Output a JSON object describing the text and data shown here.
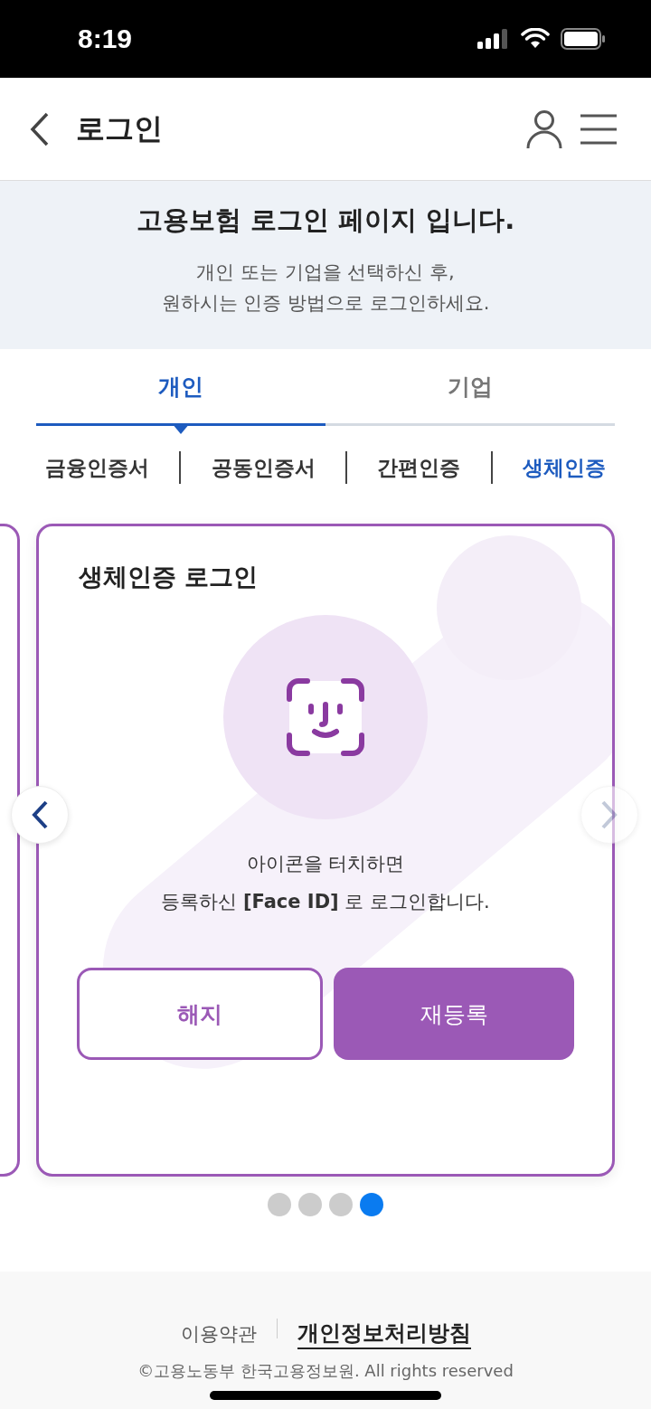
{
  "status_bar": {
    "time": "8:19"
  },
  "header": {
    "title": "로그인"
  },
  "intro": {
    "title": "고용보험 로그인 페이지 입니다.",
    "lines": [
      "개인 또는 기업을 선택하신 후,",
      "원하시는 인증 방법으로 로그인하세요."
    ]
  },
  "tabs": [
    {
      "label": "개인",
      "selected": true
    },
    {
      "label": "기업",
      "selected": false
    }
  ],
  "sub_tabs": [
    {
      "label": "금융인증서",
      "selected": false
    },
    {
      "label": "공동인증서",
      "selected": false
    },
    {
      "label": "간편인증",
      "selected": false
    },
    {
      "label": "생체인증",
      "selected": true
    }
  ],
  "card": {
    "title": "생체인증 로그인",
    "lines": [
      "아이콘을 터치하면",
      "등록하신 **[Face ID]** 로 로그인합니다."
    ],
    "buttons": [
      {
        "label": "해지",
        "kind": "outline"
      },
      {
        "label": "재등록",
        "kind": "filled"
      }
    ]
  },
  "carousel": {
    "prev_disabled": false,
    "next_disabled": true,
    "pages": [
      {
        "selected": false
      },
      {
        "selected": false
      },
      {
        "selected": false
      },
      {
        "selected": true
      }
    ]
  },
  "footer": {
    "links": [
      {
        "label": "이용약관",
        "kind": "plain"
      },
      {
        "label": "개인정보처리방침",
        "kind": "emphasis"
      }
    ],
    "copyright": "©고용노동부 한국고용정보원. All rights reserved"
  }
}
